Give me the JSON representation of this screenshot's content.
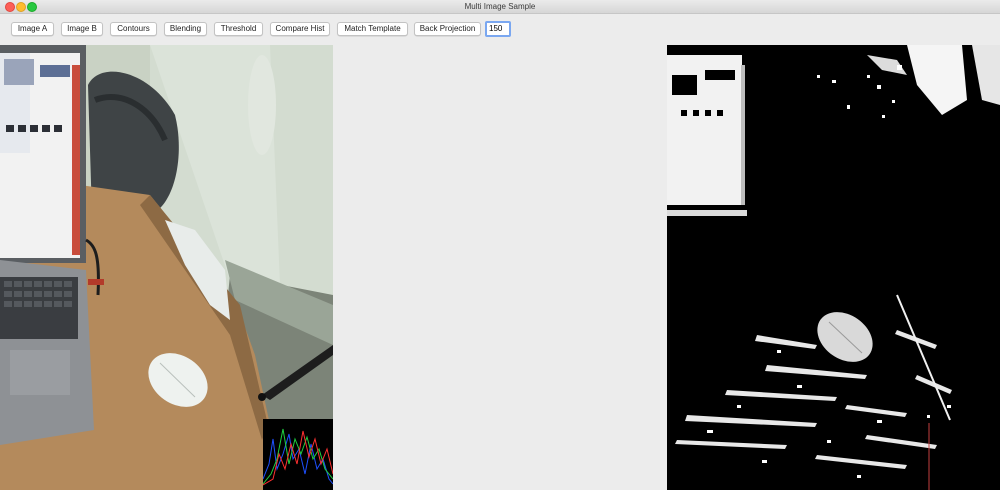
{
  "window": {
    "title": "Multi Image Sample"
  },
  "toolbar": {
    "buttons": [
      {
        "id": "image-a",
        "label": "Image A"
      },
      {
        "id": "image-b",
        "label": "Image B"
      },
      {
        "id": "contours",
        "label": "Contours"
      },
      {
        "id": "blending",
        "label": "Blending"
      },
      {
        "id": "threshold",
        "label": "Threshold"
      },
      {
        "id": "compare-hist",
        "label": "Compare Hist"
      },
      {
        "id": "match-template",
        "label": "Match Template"
      },
      {
        "id": "back-projection",
        "label": "Back Projection"
      }
    ],
    "threshold_value": "150"
  },
  "colors": {
    "window_bg": "#ececec",
    "input_focus": "#7aa7f0",
    "close": "#fd5f57",
    "minimize": "#febc2e",
    "maximize": "#28c840"
  }
}
